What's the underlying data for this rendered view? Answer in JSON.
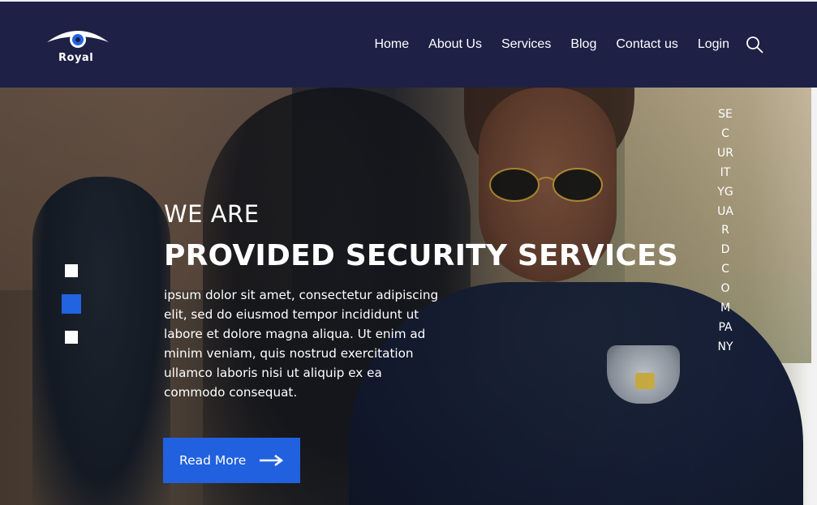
{
  "brand": {
    "name": "Royal",
    "accent": "#2163e0",
    "header_bg": "#1e2046"
  },
  "nav": {
    "items": [
      "Home",
      "About Us",
      "Services",
      "Blog",
      "Contact us",
      "Login"
    ],
    "search_icon": "search-icon"
  },
  "hero": {
    "eyebrow": "WE ARE",
    "headline": "PROVIDED SECURITY SERVICES",
    "description": "ipsum dolor sit amet, consectetur adipiscing elit, sed do eiusmod tempor incididunt ut labore et dolore magna aliqua. Ut enim ad minim veniam, quis nostrud exercitation ullamco laboris nisi ut aliquip ex ea commodo consequat.",
    "cta_label": "Read More",
    "cta_icon": "arrow-right-icon",
    "vertical_tagline": "SECURITYGUARDCOMPANY"
  },
  "slider": {
    "count": 3,
    "active_index": 2
  }
}
